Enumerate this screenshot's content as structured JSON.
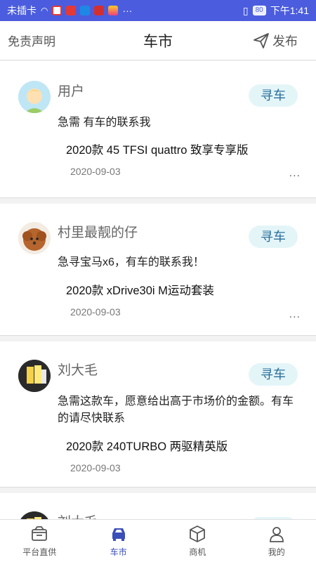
{
  "status_bar": {
    "carrier": "未插卡",
    "battery": "80",
    "time": "下午1:41",
    "more": "···"
  },
  "header": {
    "left_label": "免责声明",
    "title": "车市",
    "publish_label": "发布"
  },
  "posts": [
    {
      "user": "用户",
      "tag": "寻车",
      "message": "急需 有车的联系我",
      "model": "2020款 45 TFSI quattro 致享专享版",
      "date": "2020-09-03",
      "more": "..."
    },
    {
      "user": "村里最靓的仔",
      "tag": "寻车",
      "message": "急寻宝马x6，有车的联系我！",
      "model": "2020款 xDrive30i M运动套装",
      "date": "2020-09-03",
      "more": "..."
    },
    {
      "user": "刘大毛",
      "tag": "寻车",
      "message": "急需这款车，愿意给出高于市场价的金额。有车的请尽快联系",
      "model": "2020款 240TURBO 两驱精英版",
      "date": "2020-09-03"
    },
    {
      "user": "刘大毛",
      "tag": "寻车"
    }
  ],
  "tabs": [
    {
      "label": "平台直供",
      "icon": "box-icon"
    },
    {
      "label": "车市",
      "icon": "car-icon",
      "active": true
    },
    {
      "label": "商机",
      "icon": "cube-icon"
    },
    {
      "label": "我的",
      "icon": "user-icon"
    }
  ],
  "colors": {
    "status_bar": "#4b5dde",
    "tag_bg": "#e4f5f8",
    "tag_text": "#2a6f9c",
    "active_tab": "#3a4fb8"
  }
}
